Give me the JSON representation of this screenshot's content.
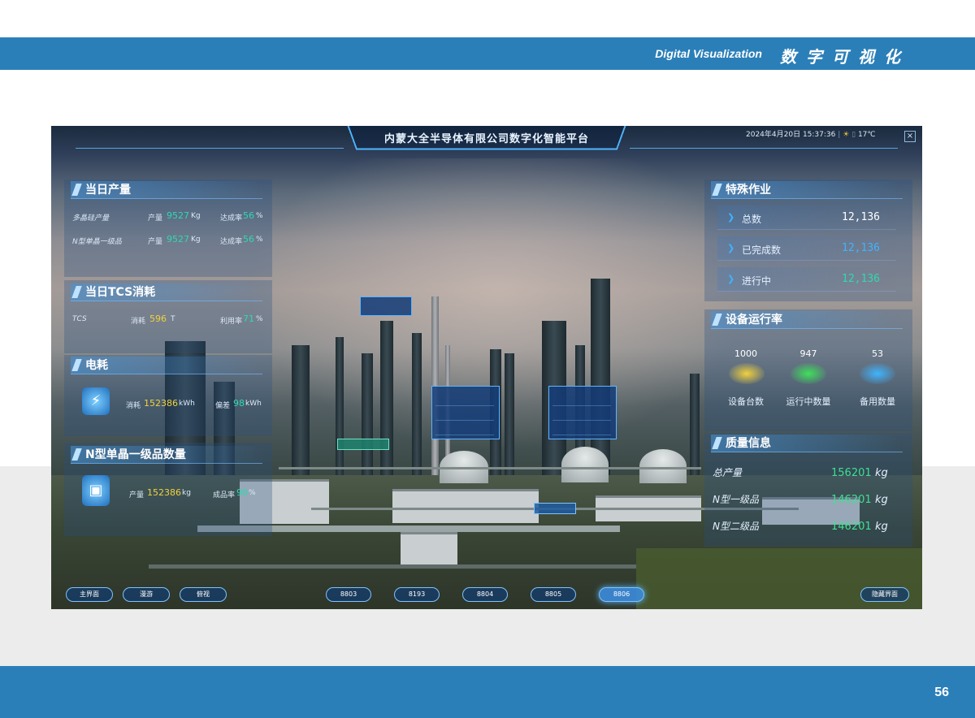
{
  "header": {
    "en": "Digital Visualization",
    "zh": "数字可视化"
  },
  "footer": {
    "page": "56"
  },
  "dashboard": {
    "title": "内蒙大全半导体有限公司数字化智能平台",
    "datetime": "2024年4月20日 15:37:36",
    "weather_icon": "sun-icon",
    "temperature": "17℃",
    "close": "×"
  },
  "left": {
    "daily_output": {
      "title": "当日产量",
      "rows": [
        {
          "name": "多晶硅产量",
          "k1": "产量",
          "v1": "9527",
          "u1": "Kg",
          "k2": "达成率",
          "v2": "56",
          "u2": "%"
        },
        {
          "name": "N型单晶一级品",
          "k1": "产量",
          "v1": "9527",
          "u1": "Kg",
          "k2": "达成率",
          "v2": "56",
          "u2": "%"
        }
      ]
    },
    "tcs": {
      "title": "当日TCS消耗",
      "row": {
        "name": "TCS",
        "k1": "消耗",
        "v1": "596",
        "u1": "T",
        "k2": "利用率",
        "v2": "71",
        "u2": "%"
      }
    },
    "power": {
      "title": "电耗",
      "row": {
        "k1": "消耗",
        "v1": "152386",
        "u1": "kWh",
        "k2": "偏差",
        "v2": "98",
        "u2": "kWh"
      }
    },
    "ntype": {
      "title": "N型单晶一级品数量",
      "row": {
        "k1": "产量",
        "v1": "152386",
        "u1": "kg",
        "k2": "成品率",
        "v2": "98",
        "u2": "%"
      }
    }
  },
  "right": {
    "special": {
      "title": "特殊作业",
      "rows": [
        {
          "label": "总数",
          "value": "12,136"
        },
        {
          "label": "已完成数",
          "value": "12,136"
        },
        {
          "label": "进行中",
          "value": "12,136"
        }
      ]
    },
    "equipment": {
      "title": "设备运行率",
      "items": [
        {
          "value": "1000",
          "label": "设备台数",
          "color": "#f2d13d"
        },
        {
          "value": "947",
          "label": "运行中数量",
          "color": "#3fe05a"
        },
        {
          "value": "53",
          "label": "备用数量",
          "color": "#3fb4ff"
        }
      ]
    },
    "quality": {
      "title": "质量信息",
      "rows": [
        {
          "label": "总产量",
          "value": "156201",
          "unit": "kg"
        },
        {
          "label": "N型一级品",
          "value": "146201",
          "unit": "kg"
        },
        {
          "label": "N型二级品",
          "value": "146201",
          "unit": "kg"
        }
      ]
    }
  },
  "nav": {
    "left": [
      "主界面",
      "漫游",
      "俯视"
    ],
    "units": [
      "8803",
      "8193",
      "8804",
      "8805",
      "8806"
    ],
    "active": "8806",
    "right": "隐藏界面"
  }
}
